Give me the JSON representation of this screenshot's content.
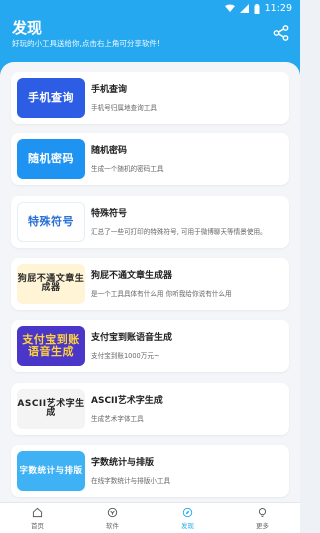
{
  "statusbar": {
    "time": "11:29"
  },
  "header": {
    "title": "发现",
    "subtitle": "好玩的小工具送给你,点击右上角可分享软件!"
  },
  "tools": [
    {
      "thumb_text": "手机查询",
      "title": "手机查询",
      "desc": "手机号归属地查询工具"
    },
    {
      "thumb_text": "随机密码",
      "title": "随机密码",
      "desc": "生成一个随机的密码工具"
    },
    {
      "thumb_text": "特殊符号",
      "title": "特殊符号",
      "desc": "汇总了一些可打印的特殊符号, 可用于微博聊天等情景使用。"
    },
    {
      "thumb_text": "狗屁不通文章生成器",
      "title": "狗屁不通文章生成器",
      "desc": "是一个工具具体有什么用 你听我给你说有什么用"
    },
    {
      "thumb_text": "支付宝到账语音生成",
      "title": "支付宝到账语音生成",
      "desc": "支付宝到账1000万元~"
    },
    {
      "thumb_text": "ASCII艺术字生成",
      "title": "ASCII艺术字生成",
      "desc": "生成艺术字体工具"
    },
    {
      "thumb_text": "字数统计与排版",
      "title": "字数统计与排版",
      "desc": "在线字数统计与排版小工具"
    }
  ],
  "tabs": [
    {
      "label": "首页",
      "icon": "home-icon"
    },
    {
      "label": "软件",
      "icon": "app-icon"
    },
    {
      "label": "发现",
      "icon": "compass-icon"
    },
    {
      "label": "更多",
      "icon": "bulb-icon"
    }
  ],
  "colors": {
    "accent": "#26a8f0",
    "background": "#f3f5f8"
  }
}
